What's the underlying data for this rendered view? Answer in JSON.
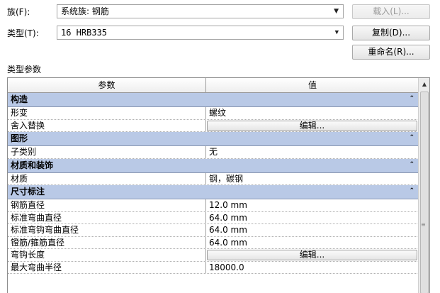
{
  "family": {
    "label": "族(F):",
    "value": "系统族: 钢筋",
    "load_button": "载入(L)..."
  },
  "type": {
    "label": "类型(T):",
    "value": "16 HRB335",
    "duplicate_button": "复制(D)...",
    "rename_button": "重命名(R)..."
  },
  "section_title": "类型参数",
  "table": {
    "col_param": "参数",
    "col_value": "值",
    "groups": [
      {
        "name": "构造",
        "rows": [
          {
            "param": "形变",
            "value": "螺纹"
          },
          {
            "param": "舍入替换",
            "button": "编辑..."
          }
        ]
      },
      {
        "name": "图形",
        "rows": [
          {
            "param": "子类别",
            "value": "无"
          }
        ]
      },
      {
        "name": "材质和装饰",
        "rows": [
          {
            "param": "材质",
            "value": "钢，碳钢"
          }
        ]
      },
      {
        "name": "尺寸标注",
        "rows": [
          {
            "param": "钢筋直径",
            "value": "12.0 mm"
          },
          {
            "param": "标准弯曲直径",
            "value": "64.0 mm"
          },
          {
            "param": "标准弯钩弯曲直径",
            "value": "64.0 mm"
          },
          {
            "param": "镫筋/箍筋直径",
            "value": "64.0 mm"
          },
          {
            "param": "弯钩长度",
            "button": "编辑..."
          },
          {
            "param": "最大弯曲半径",
            "value": "18000.0"
          }
        ]
      }
    ]
  },
  "icons": {
    "dropdown": "dropdown-arrow-icon",
    "collapse": "collapse-chevron-icon"
  }
}
